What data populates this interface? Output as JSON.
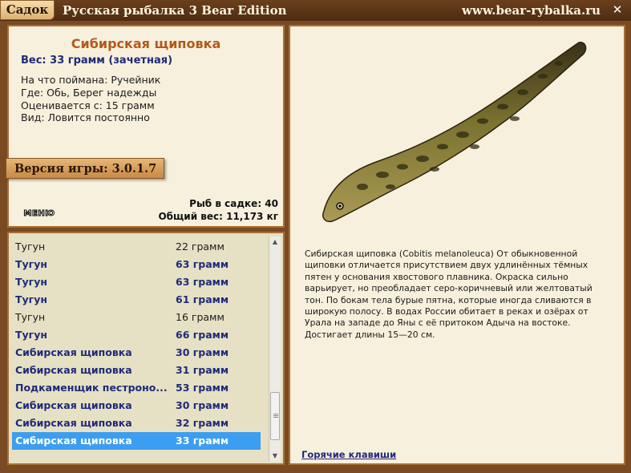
{
  "window": {
    "tab": "Садок",
    "title": "Русская рыбалка 3 Bear Edition",
    "site": "www.bear-rybalka.ru",
    "close_glyph": "✕"
  },
  "fish": {
    "name": "Сибирская щиповка",
    "weight_line": "Вес: 33 грамм (зачетная)",
    "bait": "На что поймана: Ручейник",
    "place": "Где: Обь, Берег надежды",
    "rated_from": "Оценивается с: 15 грамм",
    "kind": "Вид: Ловится постоянно"
  },
  "version": "Версия игры: 3.0.1.7",
  "menu_label": "МЕНЮ",
  "totals": {
    "count": "Рыб в садке: 40",
    "weight": "Общий вес: 11,173 кг"
  },
  "catch_list": [
    {
      "name": "Тугун",
      "weight": "22 грамм",
      "style": "plain"
    },
    {
      "name": "Тугун",
      "weight": "63 грамм",
      "style": "caught"
    },
    {
      "name": "Тугун",
      "weight": "63 грамм",
      "style": "caught"
    },
    {
      "name": "Тугун",
      "weight": "61 грамм",
      "style": "caught"
    },
    {
      "name": "Тугун",
      "weight": "16 грамм",
      "style": "plain"
    },
    {
      "name": "Тугун",
      "weight": "66 грамм",
      "style": "caught"
    },
    {
      "name": "Сибирская щиповка",
      "weight": "30 грамм",
      "style": "caught"
    },
    {
      "name": "Сибирская щиповка",
      "weight": "31 грамм",
      "style": "caught"
    },
    {
      "name": "Подкаменщик пестроно...",
      "weight": "53 грамм",
      "style": "caught"
    },
    {
      "name": "Сибирская щиповка",
      "weight": "30 грамм",
      "style": "caught"
    },
    {
      "name": "Сибирская щиповка",
      "weight": "32 грамм",
      "style": "caught"
    },
    {
      "name": "Сибирская щиповка",
      "weight": "33 грамм",
      "style": "selected"
    }
  ],
  "description": "Сибирская щиповка (Cobitis melanoleuca) От обыкновенной щиповки отличается присутствием двух удлинённых тёмных пятен у основания хвостового плавника. Окраска сильно варьирует, но преобладает серо-коричневый или желтоватый тон. По бокам тела бурые пятна, которые иногда сливаются в широкую полосу. В водах России обитает в реках и озёрах от Урала на западе до Яны с её притоком Адыча на востоке. Достигает длины  15—20 см.",
  "hotkeys_link": "Горячие клавиши",
  "colors": {
    "frame": "#7a4a22",
    "panel": "#f7f0dc",
    "title_accent": "#b5581a",
    "caught_text": "#1f2a7a",
    "selection": "#3b9ef1"
  }
}
